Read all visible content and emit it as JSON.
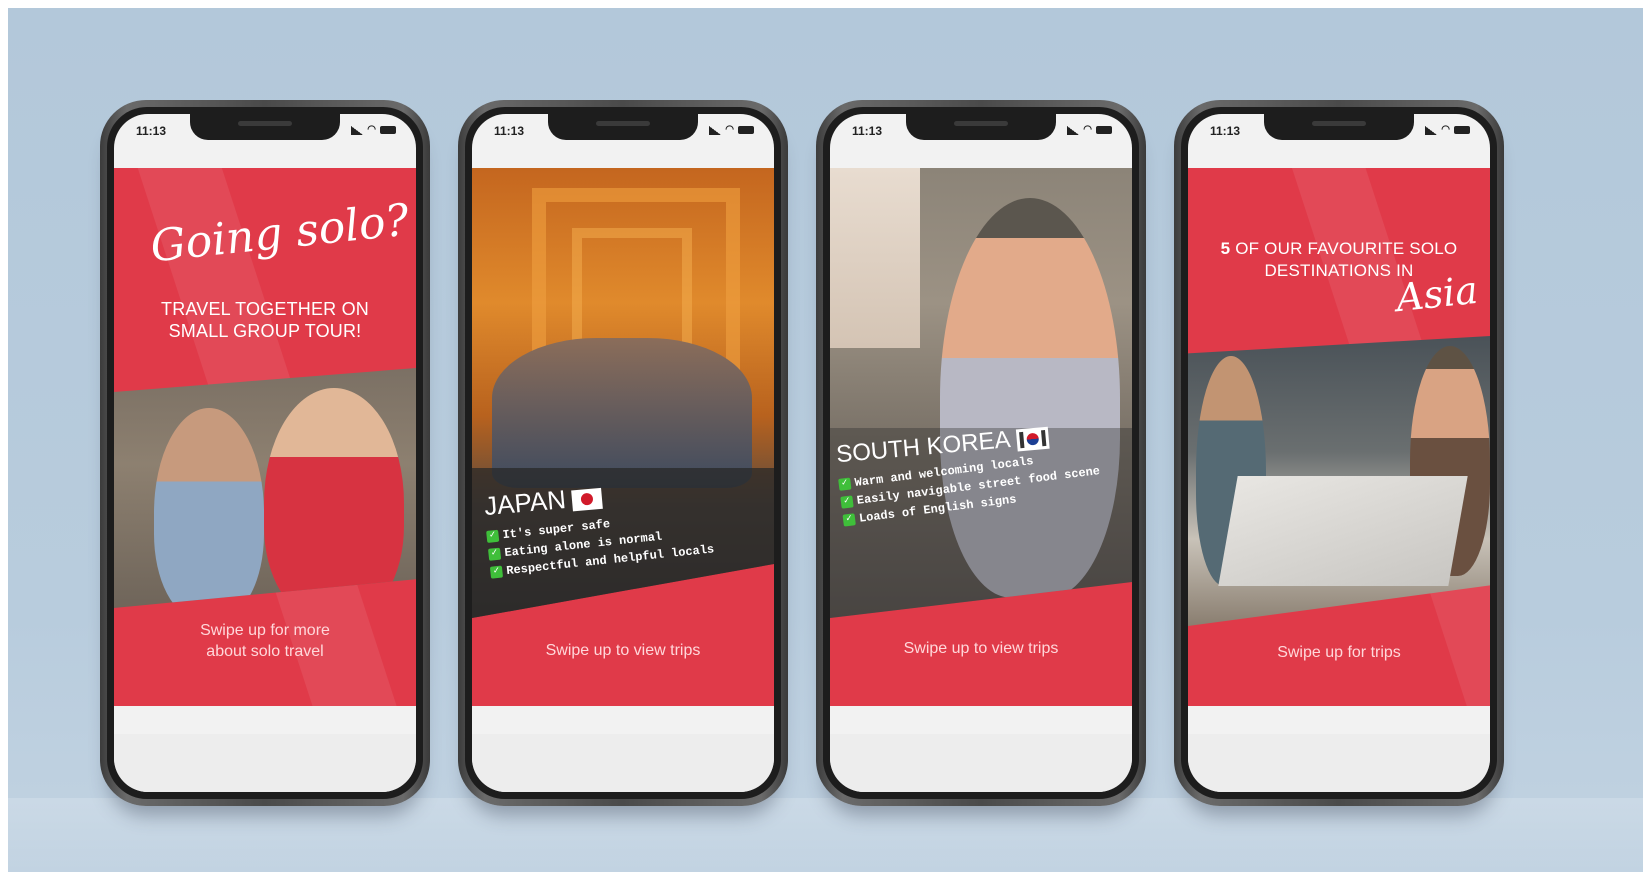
{
  "status_time": "11:13",
  "colors": {
    "accent": "#e03a49",
    "background": "#b3c8da"
  },
  "icons": [
    "signal-icon",
    "wifi-icon",
    "battery-icon",
    "check-icon",
    "japan-flag-icon",
    "south-korea-flag-icon"
  ],
  "phones": [
    {
      "script_heading": "Going solo?",
      "headline_lines": [
        "TRAVEL TOGETHER ON",
        "SMALL GROUP TOUR!"
      ],
      "cta_lines": [
        "Swipe up for more",
        "about solo travel"
      ]
    },
    {
      "country": "JAPAN",
      "bullets": [
        "It's super safe",
        "Eating alone is normal",
        "Respectful and helpful locals"
      ],
      "cta": "Swipe up to view trips"
    },
    {
      "country": "SOUTH KOREA",
      "bullets": [
        "Warm and welcoming locals",
        "Easily navigable street food scene",
        "Loads of English signs"
      ],
      "cta": "Swipe up to view trips"
    },
    {
      "number": "5",
      "headline_line1": "OF OUR FAVOURITE SOLO",
      "headline_line2": "DESTINATIONS IN",
      "script_word": "Asia",
      "cta": "Swipe up for trips"
    }
  ]
}
